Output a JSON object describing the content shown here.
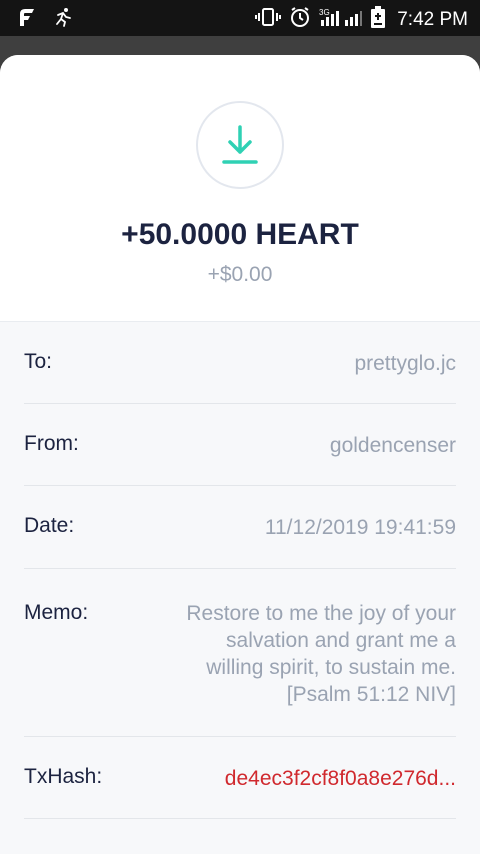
{
  "status_bar": {
    "time": "7:42 PM",
    "network": "3G",
    "icons": [
      "app-icon",
      "running-icon",
      "vibrate-icon",
      "alarm-icon",
      "signal-icon",
      "battery-icon"
    ]
  },
  "transaction": {
    "amount": "+50.0000 HEART",
    "fiat": "+$0.00",
    "icon": "download-icon",
    "accent_color": "#2fd1b4"
  },
  "details": {
    "to_label": "To:",
    "to_value": "prettyglo.jc",
    "from_label": "From:",
    "from_value": "goldencenser",
    "date_label": "Date:",
    "date_value": "11/12/2019 19:41:59",
    "memo_label": "Memo:",
    "memo_value": "Restore to me the joy of your\nsalvation and grant me a\nwilling spirit, to sustain me.\n[Psalm 51:12 NIV]",
    "txhash_label": "TxHash:",
    "txhash_value": "de4ec3f2cf8f0a8e276d...",
    "txhash_color": "#d0292e"
  }
}
